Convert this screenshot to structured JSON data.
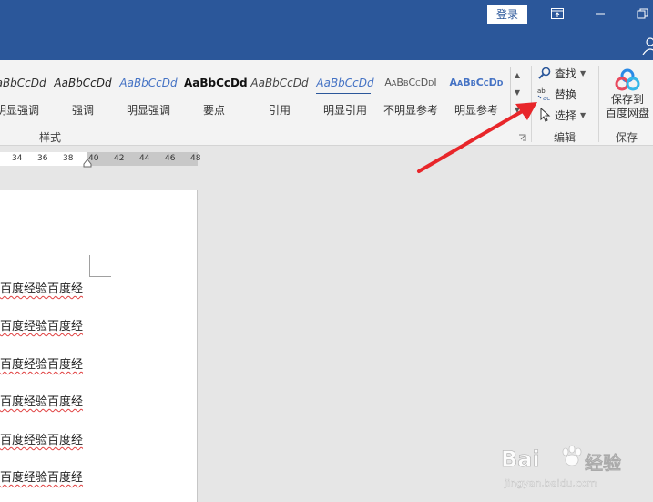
{
  "titlebar": {
    "login_label": "登录",
    "icons": [
      "ribbon-display-options-icon",
      "minimize-icon",
      "restore-icon",
      "user-icon"
    ]
  },
  "ribbon": {
    "styles": {
      "items": [
        {
          "sample": "AaBbCcDd",
          "name": "明显强调"
        },
        {
          "sample": "AaBbCcDd",
          "name": "强调"
        },
        {
          "sample": "AaBbCcDd",
          "name": "明显强调"
        },
        {
          "sample": "AaBbCcDd",
          "name": "要点"
        },
        {
          "sample": "AaBbCcDd",
          "name": "引用"
        },
        {
          "sample": "AaBbCcDd",
          "name": "明显引用"
        },
        {
          "sample": "AaBbCcDdI",
          "name": "不明显参考"
        },
        {
          "sample": "AaBbCcDd",
          "name": "明显参考"
        }
      ],
      "group_label": "样式"
    },
    "editing": {
      "find_label": "查找",
      "replace_label": "替换",
      "select_label": "选择",
      "group_label": "编辑"
    },
    "save": {
      "button_line1": "保存到",
      "button_line2": "百度网盘",
      "group_label": "保存"
    }
  },
  "ruler": {
    "ticks": [
      "34",
      "36",
      "38",
      "40",
      "42",
      "44",
      "46",
      "48"
    ]
  },
  "document": {
    "lines": [
      "百度经验百度经",
      "百度经验百度经",
      "百度经验百度经",
      "百度经验百度经",
      "百度经验百度经",
      "百度经验百度经"
    ]
  },
  "watermark": {
    "brand": "Bai",
    "brand_tail": "经验",
    "url": "jingyan.baidu.com"
  },
  "colors": {
    "titlebar": "#2b579a",
    "annotation_arrow": "#e8262a",
    "spellcheck_underline": "#e04040"
  }
}
